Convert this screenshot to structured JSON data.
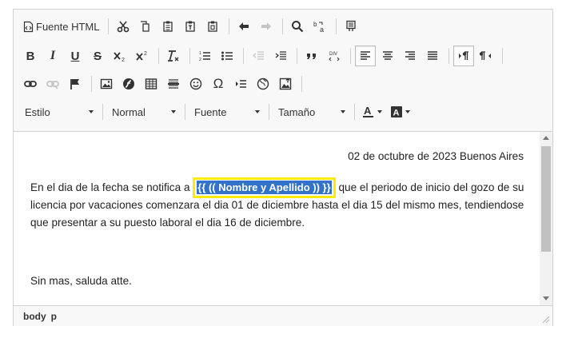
{
  "toolbar": {
    "source_label": "Fuente HTML",
    "combos": {
      "style": "Estilo",
      "format": "Normal",
      "font": "Fuente",
      "size": "Tamaño"
    },
    "buttons": {
      "bold": "B",
      "italic": "I",
      "underline": "U",
      "strike": "S",
      "omega": "Ω"
    }
  },
  "content": {
    "date_line": "02 de octubre de 2023 Buenos Aires",
    "para_before": "En el dia de la fecha se notifica a ",
    "placeholder": "{{ (( Nombre y Apellido )) }}",
    "para_after": " que el periodo de inicio del gozo de su licencia por vacaciones comenzara el dia 01 de diciembre hasta el dia 15 del mismo mes, tendiendose que presentar a su puesto laboral el dia 16 de diciembre.",
    "closing": "Sin mas, saluda atte."
  },
  "statusbar": {
    "path": [
      "body",
      "p"
    ]
  },
  "colors": {
    "highlight_bg": "#3272c9",
    "highlight_border": "#ffeb00"
  }
}
